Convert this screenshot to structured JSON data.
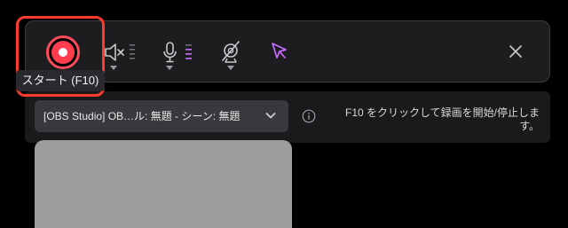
{
  "toolbar": {
    "record_tooltip": "スタート (F10)",
    "icons": [
      "record-icon",
      "speaker-muted-icon",
      "microphone-icon",
      "webcam-off-icon",
      "cursor-icon",
      "close-icon"
    ]
  },
  "source": {
    "selected": "[OBS Studio] OB…ル: 無題 - シーン: 無題"
  },
  "hint": {
    "text": "F10 をクリックして録画を開始/停止します。"
  },
  "colors": {
    "record": "#ff3d4f",
    "highlight": "#ff3b30",
    "accent": "#c86cff",
    "background": "#000000"
  }
}
